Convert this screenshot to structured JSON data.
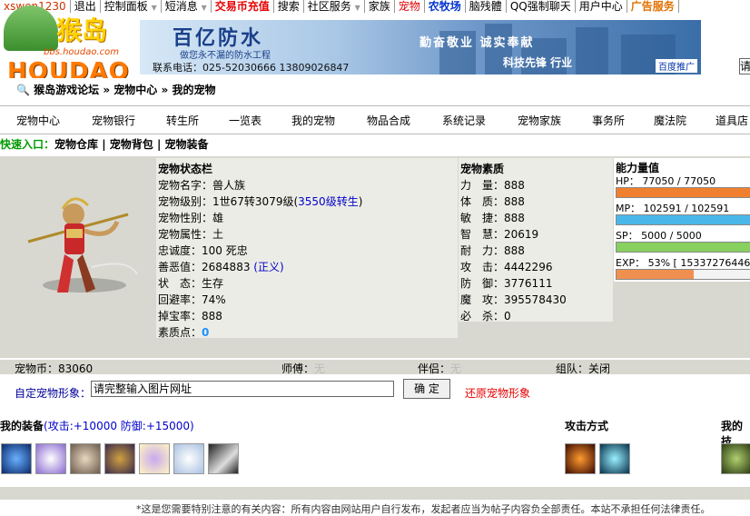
{
  "topbar": {
    "user": "xswen1230",
    "items": [
      "退出",
      "控制面板",
      "短消息",
      "交易币充值",
      "搜索",
      "社区服务",
      "家族",
      "宠物",
      "农牧场",
      "脑残體",
      "QQ强制聊天",
      "用户中心",
      "广告服务"
    ]
  },
  "logo": {
    "title": "猴岛",
    "url": "bbs.houdao.com",
    "brand": "HOUDAO"
  },
  "banner": {
    "title": "百亿防水",
    "subtitle": "做您永不漏的防水工程",
    "phone": "联系电话：025-52030666  13809026847",
    "slogan": "勤奋敬业  诚实奉献",
    "slogan2": "科技先锋  行业",
    "tag": "百度推广"
  },
  "search": {
    "text": "请"
  },
  "breadcrumb": {
    "root": "猴岛游戏论坛",
    "sep1": "»",
    "mid": "宠物中心",
    "sep2": "»",
    "current": "我的宠物"
  },
  "nav": [
    "宠物中心",
    "宠物银行",
    "转生所",
    "一览表",
    "我的宠物",
    "物品合成",
    "系统记录",
    "宠物家族",
    "事务所",
    "魔法院",
    "道具店"
  ],
  "quick": {
    "label": "快速入口：",
    "links": [
      "宠物仓库",
      "宠物背包",
      "宠物装备"
    ]
  },
  "status": {
    "header": "宠物状态栏",
    "name_label": "宠物名字：",
    "name": "兽人族",
    "level_label": "宠物级别：",
    "level": "1世67转3079级(",
    "level_link": "3550级转生",
    "level_end": ")",
    "gender_label": "宠物性别：",
    "gender": "雄",
    "attr_label": "宠物属性：",
    "attr": "土",
    "loyalty_label": "忠诚度：",
    "loyalty": "100 死忠",
    "karma_label": "善恶值：",
    "karma": "2684883",
    "karma_tag": "(正义)",
    "state_label": "状　态：",
    "state": "生存",
    "evade_label": "回避率：",
    "evade": "74%",
    "drop_label": "掉宝率：",
    "drop": "888",
    "points_label": "素质点：",
    "points": "0"
  },
  "quality": {
    "header": "宠物素质",
    "rows": [
      {
        "label": "力　量：",
        "value": "888"
      },
      {
        "label": "体　质：",
        "value": "888"
      },
      {
        "label": "敏　捷：",
        "value": "888"
      },
      {
        "label": "智　慧：",
        "value": "20619"
      },
      {
        "label": "耐　力：",
        "value": "888"
      },
      {
        "label": "攻　击：",
        "value": "4442296"
      },
      {
        "label": "防　御：",
        "value": "3776111"
      },
      {
        "label": "魔　攻：",
        "value": "395578430"
      },
      {
        "label": "必　杀：",
        "value": "0"
      }
    ]
  },
  "ability": {
    "header": "能力量值",
    "hp": "HP： 77050 / 77050",
    "hp_pct": 1.0,
    "mp": "MP： 102591 / 102591",
    "mp_pct": 1.0,
    "sp": "SP： 5000 / 5000",
    "sp_pct": 1.0,
    "exp": "EXP： 53% [ 15337276446",
    "exp_pct": 0.53,
    "colors": {
      "hp": "#f08030",
      "mp": "#49b8e8",
      "sp": "#88d060",
      "exp": "#f09050"
    }
  },
  "info": {
    "coins_label": "宠物币：",
    "coins": "83060",
    "master_label": "师傅：",
    "master": "无",
    "mate_label": "伴侣：",
    "mate": "无",
    "team_label": "组队：",
    "team": "关闭"
  },
  "custom": {
    "label": "自定宠物形象：",
    "input_value": "请完整输入图片网址",
    "confirm": "确 定",
    "restore": "还原宠物形象"
  },
  "equip": {
    "title": "我的装备",
    "stats": "(攻击:+10000 防御:+15000)",
    "attack_title": "攻击方式",
    "my_title": "我的技"
  },
  "footer": {
    "text": "*这是您需要特别注意的有关内容：所有内容由网站用户自行发布，发起者应当为帖子内容负全部责任。本站不承担任何法律责任。"
  }
}
